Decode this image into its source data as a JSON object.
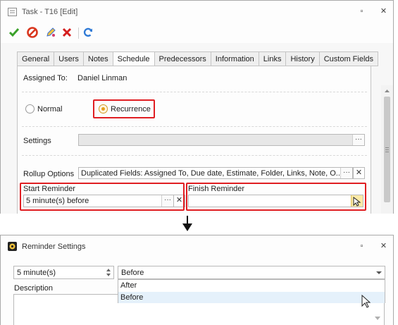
{
  "task_window": {
    "title": "Task - T16 [Edit]",
    "controls": {
      "restore": "▫",
      "close": "✕"
    },
    "toolbar": [
      {
        "name": "save-icon",
        "glyph": "✔",
        "color": "#3aa12a"
      },
      {
        "name": "cancel-icon",
        "glyph": "⊘",
        "color": "#d9361e"
      },
      {
        "name": "edit-icon",
        "glyph": "✎",
        "color": "#3b6fd1"
      },
      {
        "name": "delete-icon",
        "glyph": "✖",
        "color": "#d41e1e"
      },
      {
        "name": "refresh-icon",
        "glyph": "↻",
        "color": "#2f7ad6"
      }
    ],
    "tabs": [
      "General",
      "Users",
      "Notes",
      "Schedule",
      "Predecessors",
      "Information",
      "Links",
      "History",
      "Custom Fields"
    ],
    "active_tab": "Schedule",
    "assigned_to_label": "Assigned To:",
    "assigned_to_value": "Daniel Linman",
    "radio_normal": "Normal",
    "radio_recurrence": "Recurrence",
    "settings_label": "Settings",
    "settings_value": "",
    "rollup_label": "Rollup Options",
    "rollup_value": "Duplicated Fields: Assigned To, Due date, Estimate, Folder, Links, Note, O...",
    "start_reminder_label": "Start Reminder",
    "start_reminder_value": "5 minute(s) before",
    "finish_reminder_label": "Finish Reminder",
    "finish_reminder_value": "",
    "ellipsis": "···",
    "clear": "✕"
  },
  "reminder_window": {
    "title": "Reminder Settings",
    "controls": {
      "restore": "▫",
      "close": "✕"
    },
    "amount_value": "5 minute(s)",
    "direction_value": "Before",
    "options": [
      "After",
      "Before"
    ],
    "description_label": "Description"
  },
  "colors": {
    "highlight": "#e01e22",
    "dropdown_hover": "#e5f1fb",
    "radio_selected": "#e6a11c"
  }
}
